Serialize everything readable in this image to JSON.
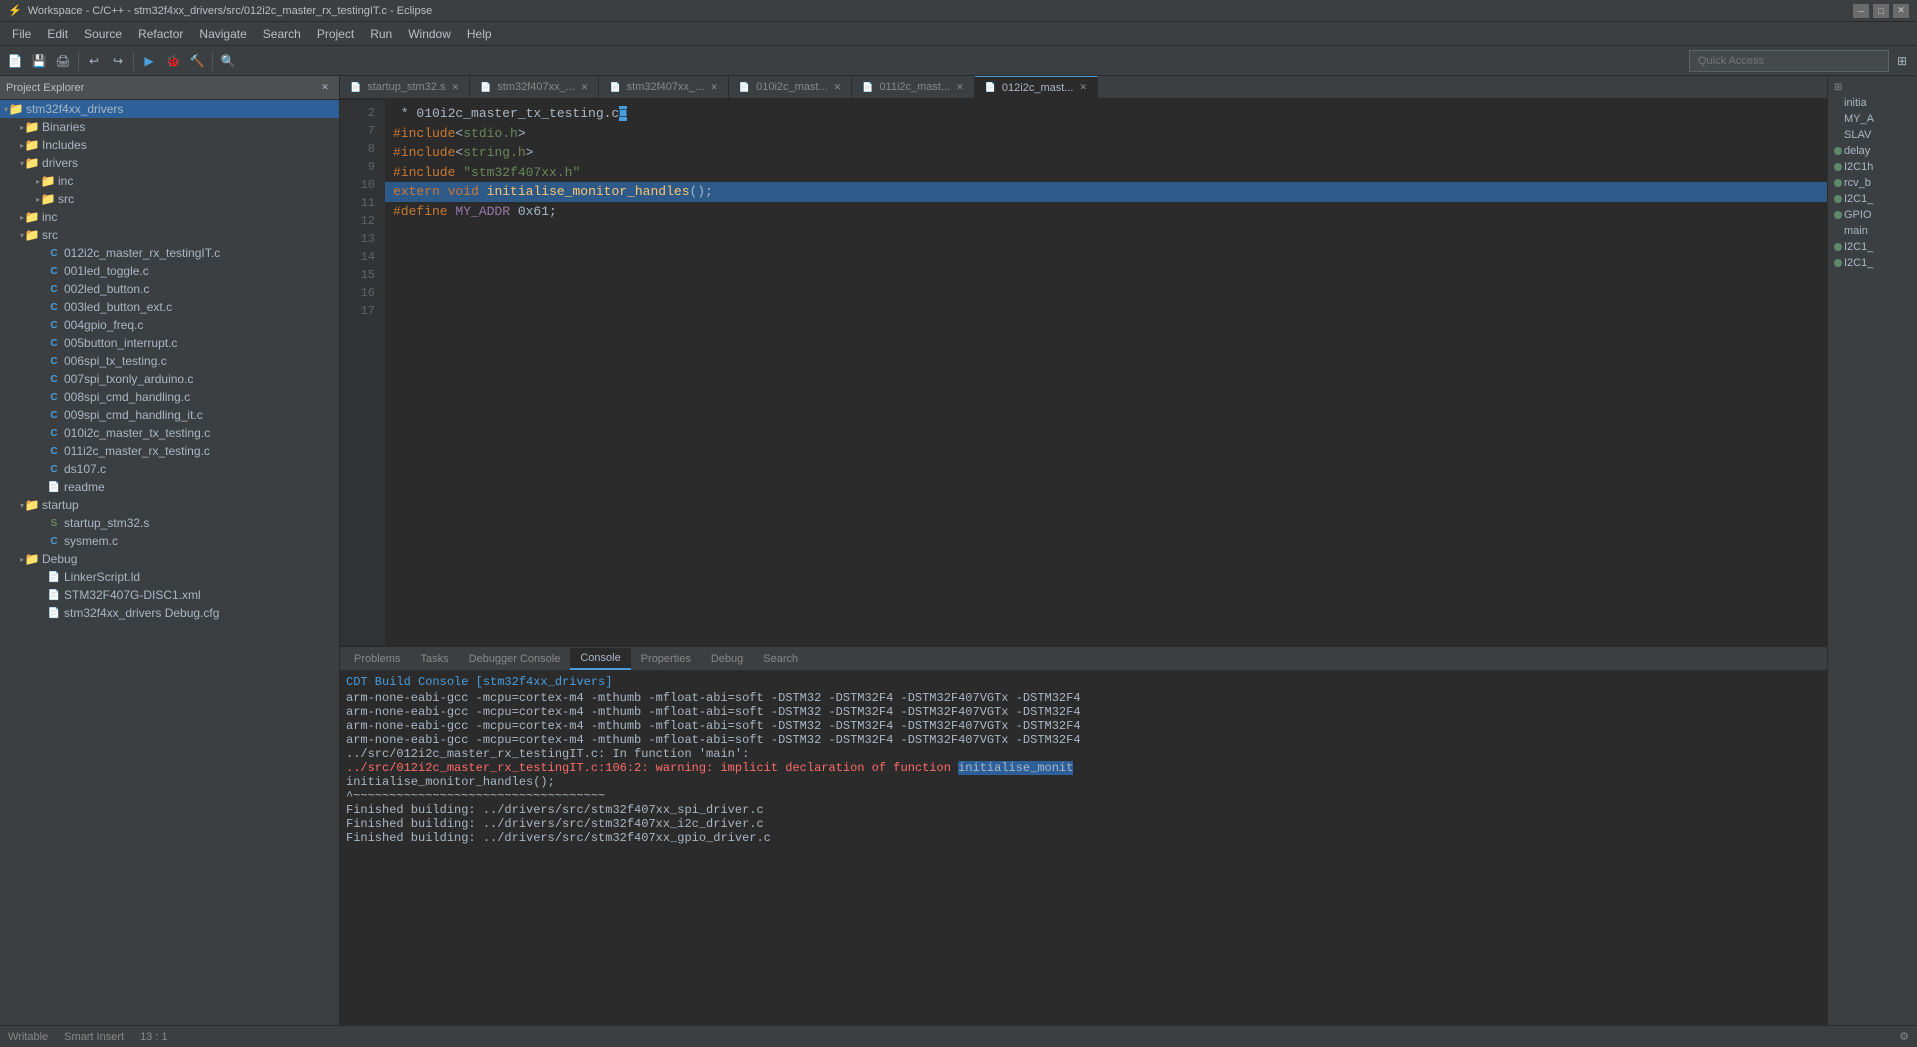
{
  "titleBar": {
    "title": "Workspace - C/C++ - stm32f4xx_drivers/src/012i2c_master_rx_testingIT.c - Eclipse",
    "minimize": "─",
    "maximize": "□",
    "close": "✕"
  },
  "menuBar": {
    "items": [
      "File",
      "Edit",
      "Source",
      "Refactor",
      "Navigate",
      "Search",
      "Project",
      "Run",
      "Window",
      "Help"
    ]
  },
  "toolbar": {
    "quickAccess": "Quick Access"
  },
  "projectExplorer": {
    "title": "Project Explorer",
    "tree": [
      {
        "id": "stm32f4xx_drivers",
        "label": "stm32f4xx_drivers",
        "level": 0,
        "type": "project",
        "expanded": true,
        "selected": true
      },
      {
        "id": "binaries",
        "label": "Binaries",
        "level": 1,
        "type": "folder",
        "expanded": false
      },
      {
        "id": "includes",
        "label": "Includes",
        "level": 1,
        "type": "folder",
        "expanded": false
      },
      {
        "id": "drivers",
        "label": "drivers",
        "level": 1,
        "type": "folder",
        "expanded": true
      },
      {
        "id": "inc-drivers",
        "label": "inc",
        "level": 2,
        "type": "folder",
        "expanded": false
      },
      {
        "id": "src-drivers",
        "label": "src",
        "level": 2,
        "type": "folder",
        "expanded": false
      },
      {
        "id": "inc",
        "label": "inc",
        "level": 1,
        "type": "folder",
        "expanded": false
      },
      {
        "id": "src",
        "label": "src",
        "level": 1,
        "type": "folder",
        "expanded": true
      },
      {
        "id": "012i2c",
        "label": "012i2c_master_rx_testingIT.c",
        "level": 2,
        "type": "file-c",
        "expanded": false
      },
      {
        "id": "001led",
        "label": "001led_toggle.c",
        "level": 2,
        "type": "file-c",
        "expanded": false
      },
      {
        "id": "002led",
        "label": "002led_button.c",
        "level": 2,
        "type": "file-c",
        "expanded": false
      },
      {
        "id": "003led",
        "label": "003led_button_ext.c",
        "level": 2,
        "type": "file-c",
        "expanded": false
      },
      {
        "id": "004gpio",
        "label": "004gpio_freq.c",
        "level": 2,
        "type": "file-c",
        "expanded": false
      },
      {
        "id": "005btn",
        "label": "005button_interrupt.c",
        "level": 2,
        "type": "file-c",
        "expanded": false
      },
      {
        "id": "006spi",
        "label": "006spi_tx_testing.c",
        "level": 2,
        "type": "file-c",
        "expanded": false
      },
      {
        "id": "007spi",
        "label": "007spi_txonly_arduino.c",
        "level": 2,
        "type": "file-c",
        "expanded": false
      },
      {
        "id": "008spi",
        "label": "008spi_cmd_handling.c",
        "level": 2,
        "type": "file-c",
        "expanded": false
      },
      {
        "id": "009spi",
        "label": "009spi_cmd_handling_it.c",
        "level": 2,
        "type": "file-c",
        "expanded": false
      },
      {
        "id": "010i2c",
        "label": "010i2c_master_tx_testing.c",
        "level": 2,
        "type": "file-c",
        "expanded": false
      },
      {
        "id": "011i2c",
        "label": "011i2c_master_rx_testing.c",
        "level": 2,
        "type": "file-c",
        "expanded": false
      },
      {
        "id": "ds107",
        "label": "ds107.c",
        "level": 2,
        "type": "file-c",
        "expanded": false
      },
      {
        "id": "readme",
        "label": "readme",
        "level": 2,
        "type": "file-txt",
        "expanded": false
      },
      {
        "id": "startup",
        "label": "startup",
        "level": 1,
        "type": "folder",
        "expanded": true
      },
      {
        "id": "startup_stm32",
        "label": "startup_stm32.s",
        "level": 2,
        "type": "file-s",
        "expanded": false
      },
      {
        "id": "sysmem",
        "label": "sysmem.c",
        "level": 2,
        "type": "file-c",
        "expanded": false
      },
      {
        "id": "debug",
        "label": "Debug",
        "level": 1,
        "type": "folder",
        "expanded": false
      },
      {
        "id": "linker",
        "label": "LinkerScript.ld",
        "level": 2,
        "type": "file-txt",
        "expanded": false
      },
      {
        "id": "stm32f407g",
        "label": "STM32F407G-DISC1.xml",
        "level": 2,
        "type": "file-txt",
        "expanded": false
      },
      {
        "id": "stm32f4debug",
        "label": "stm32f4xx_drivers Debug.cfg",
        "level": 2,
        "type": "file-txt",
        "expanded": false
      }
    ]
  },
  "editorTabs": [
    {
      "id": "startup_stm32",
      "label": "startup_stm32.s",
      "active": false,
      "modified": false
    },
    {
      "id": "stm32f407xx_1",
      "label": "stm32f407xx_...",
      "active": false,
      "modified": false
    },
    {
      "id": "stm32f407xx_2",
      "label": "stm32f407xx_...",
      "active": false,
      "modified": false
    },
    {
      "id": "010i2c_mast",
      "label": "010i2c_mast...",
      "active": false,
      "modified": false
    },
    {
      "id": "011i2c_mast",
      "label": "011i2c_mast...",
      "active": false,
      "modified": false
    },
    {
      "id": "012i2c_mast",
      "label": "012i2c_mast...",
      "active": true,
      "modified": false
    }
  ],
  "codeEditor": {
    "filename": "012i2c_master_rx_testingIT.c",
    "lines": [
      {
        "num": "2",
        "content": " * 010i2c_master_tx_testing.c"
      },
      {
        "num": "7",
        "content": ""
      },
      {
        "num": "8",
        "content": ""
      },
      {
        "num": "9",
        "content": "#include<stdio.h>"
      },
      {
        "num": "10",
        "content": "#include<string.h>"
      },
      {
        "num": "11",
        "content": "#include \"stm32f407xx.h\""
      },
      {
        "num": "12",
        "content": ""
      },
      {
        "num": "13",
        "content": "extern void initialise_monitor_handles();"
      },
      {
        "num": "14",
        "content": ""
      },
      {
        "num": "15",
        "content": ""
      },
      {
        "num": "16",
        "content": ""
      },
      {
        "num": "17",
        "content": "#define MY_ADDR 0x61;"
      }
    ]
  },
  "bottomPanel": {
    "tabs": [
      "Problems",
      "Tasks",
      "Debugger Console",
      "Console",
      "Properties",
      "Debug",
      "Search"
    ],
    "activeTab": "Console",
    "consoleTitle": "CDT Build Console [stm32f4xx_drivers]",
    "lines": [
      {
        "type": "normal",
        "text": "arm-none-eabi-gcc -mcpu=cortex-m4 -mthumb -mfloat-abi=soft -DSTM32 -DSTM32F4 -DSTM32F407VGTx -DSTM32F4"
      },
      {
        "type": "normal",
        "text": "arm-none-eabi-gcc -mcpu=cortex-m4 -mthumb -mfloat-abi=soft -DSTM32 -DSTM32F4 -DSTM32F407VGTx -DSTM32F4"
      },
      {
        "type": "normal",
        "text": "arm-none-eabi-gcc -mcpu=cortex-m4 -mthumb -mfloat-abi=soft -DSTM32 -DSTM32F4 -DSTM32F407VGTx -DSTM32F4"
      },
      {
        "type": "normal",
        "text": "arm-none-eabi-gcc -mcpu=cortex-m4 -mthumb -mfloat-abi=soft -DSTM32 -DSTM32F4 -DSTM32F407VGTx -DSTM32F4"
      },
      {
        "type": "normal",
        "text": "../src/012i2c_master_rx_testingIT.c: In function 'main':"
      },
      {
        "type": "warning",
        "text": "../src/012i2c_master_rx_testingIT.c:106:2: warning: implicit declaration of function 'initialise_monit"
      },
      {
        "type": "normal",
        "text": "    initialise_monitor_handles();"
      },
      {
        "type": "normal",
        "text": "    ^~~~~~~~~~~~~~~~~~~~~~~~~~~~~~~~~~~~"
      },
      {
        "type": "normal",
        "text": ""
      },
      {
        "type": "success",
        "text": "Finished building: ../drivers/src/stm32f407xx_spi_driver.c"
      },
      {
        "type": "success",
        "text": "Finished building: ../drivers/src/stm32f407xx_i2c_driver.c"
      },
      {
        "type": "success",
        "text": "Finished building: ../drivers/src/stm32f407xx_gpio_driver.c"
      }
    ]
  },
  "rightPanel": {
    "items": [
      {
        "label": "initia",
        "hasDot": false
      },
      {
        "label": "MY_A",
        "hasDot": false
      },
      {
        "label": "SLAV",
        "hasDot": false
      },
      {
        "label": "delay",
        "hasDot": true
      },
      {
        "label": "I2C1h",
        "hasDot": true
      },
      {
        "label": "rcv_b",
        "hasDot": true
      },
      {
        "label": "I2C1_",
        "hasDot": true
      },
      {
        "label": "GPIO",
        "hasDot": true
      },
      {
        "label": "main",
        "hasDot": false
      },
      {
        "label": "I2C1_",
        "hasDot": true
      },
      {
        "label": "I2C1_",
        "hasDot": true
      }
    ]
  },
  "statusBar": {
    "writeStatus": "Writable",
    "insertMode": "Smart Insert",
    "position": "13 : 1"
  }
}
